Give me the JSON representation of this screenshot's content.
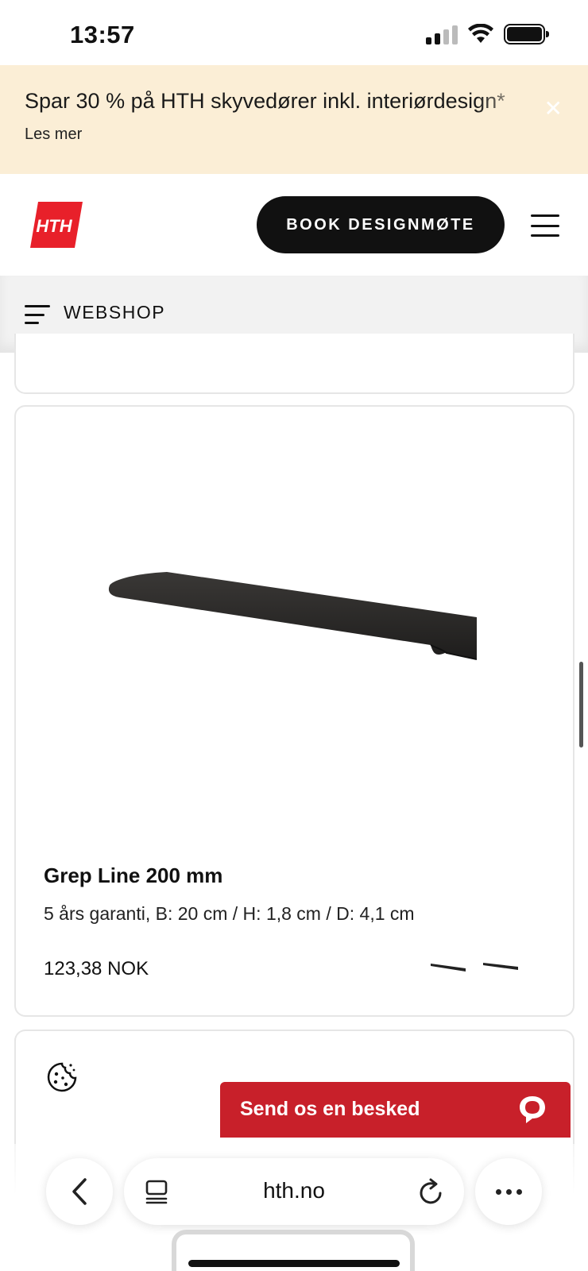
{
  "status_bar": {
    "time": "13:57"
  },
  "promo": {
    "text": "Spar 30 % på HTH skyvedører inkl. interiørdesign*",
    "link": "Les mer",
    "close_icon": "close-icon"
  },
  "header": {
    "logo_text": "HTH",
    "book_button": "BOOK DESIGNMØTE",
    "menu_icon": "hamburger-icon"
  },
  "webshop": {
    "label": "WEBSHOP",
    "icon": "category-menu-icon"
  },
  "product": {
    "title": "Grep Line 200 mm",
    "description": "5 års garanti, B: 20 cm / H: 1,8 cm / D: 4,1 cm",
    "price": "123,38 NOK",
    "variant_count": 2
  },
  "cookie": {
    "icon": "cookie-icon"
  },
  "chat": {
    "label": "Send os en besked",
    "icon": "chat-bubble-icon"
  },
  "browser": {
    "url": "hth.no",
    "back_icon": "chevron-left-icon",
    "tabs_icon": "tabs-icon",
    "reload_icon": "reload-icon",
    "more_icon": "more-icon"
  },
  "colors": {
    "promo_bg": "#fbeed6",
    "brand_red": "#e8202a",
    "chat_red": "#c8202a",
    "button_black": "#111111"
  }
}
